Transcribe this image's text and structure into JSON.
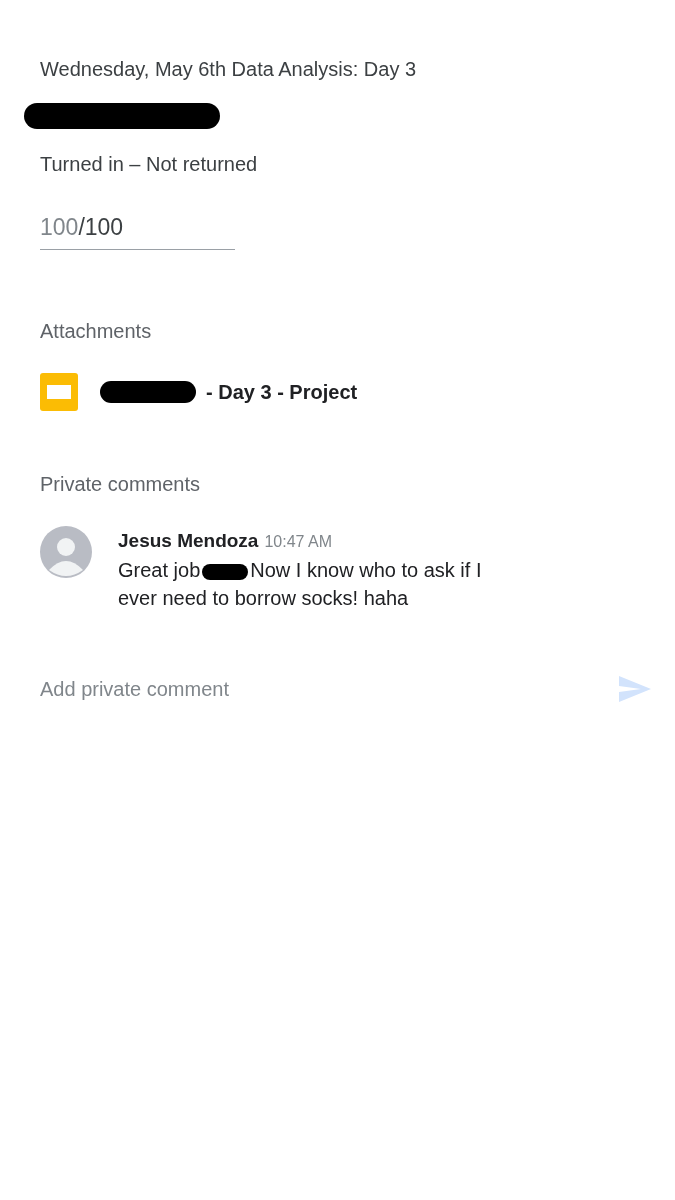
{
  "assignment": {
    "title": "Wednesday, May 6th Data Analysis: Day 3"
  },
  "student_email": {
    "redacted": true
  },
  "status": "Turned in – Not returned",
  "grade": {
    "value": "100",
    "total": "/100"
  },
  "attachments": {
    "heading": "Attachments",
    "items": [
      {
        "kind": "slides",
        "redacted": true,
        "name": "- Day 3 - Project"
      }
    ]
  },
  "private_comments": {
    "heading": "Private comments",
    "items": [
      {
        "author": "Jesus Mendoza",
        "time": "10:47 AM",
        "text_before": "Great job",
        "redacted": true,
        "text_after": "Now I know who to ask if I",
        "text_continued": "ever need to borrow socks! haha"
      }
    ]
  },
  "comment_input": {
    "placeholder": "Add private comment",
    "send_disabled": true
  }
}
